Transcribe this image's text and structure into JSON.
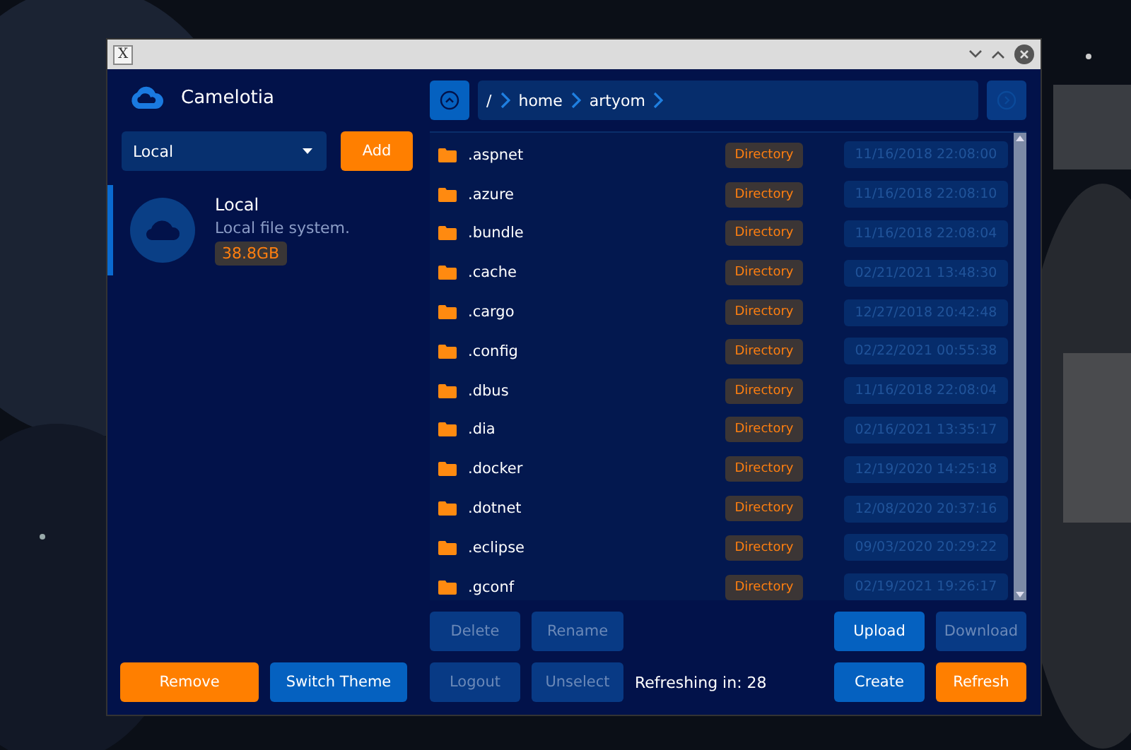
{
  "window": {
    "app_icon": "X"
  },
  "sidebar": {
    "app_name": "Camelotia",
    "storage_select": {
      "value": "Local"
    },
    "add_button": {
      "label": "Add",
      "kind": "accent",
      "disabled": false
    },
    "storages": [
      {
        "name": "Local",
        "description": "Local file system.",
        "size": "38.8GB",
        "selected": true
      }
    ],
    "buttons": [
      {
        "label": "Remove",
        "kind": "accent",
        "disabled": false
      },
      {
        "label": "Switch Theme",
        "kind": "primary",
        "disabled": false
      }
    ]
  },
  "breadcrumbs": [
    {
      "label": "/"
    },
    {
      "label": "home"
    },
    {
      "label": "artyom"
    }
  ],
  "files": [
    {
      "name": ".aspnet",
      "type": "Directory",
      "modified": "11/16/2018 22:08:00"
    },
    {
      "name": ".azure",
      "type": "Directory",
      "modified": "11/16/2018 22:08:10"
    },
    {
      "name": ".bundle",
      "type": "Directory",
      "modified": "11/16/2018 22:08:04"
    },
    {
      "name": ".cache",
      "type": "Directory",
      "modified": "02/21/2021 13:48:30"
    },
    {
      "name": ".cargo",
      "type": "Directory",
      "modified": "12/27/2018 20:42:48"
    },
    {
      "name": ".config",
      "type": "Directory",
      "modified": "02/22/2021 00:55:38"
    },
    {
      "name": ".dbus",
      "type": "Directory",
      "modified": "11/16/2018 22:08:04"
    },
    {
      "name": ".dia",
      "type": "Directory",
      "modified": "02/16/2021 13:35:17"
    },
    {
      "name": ".docker",
      "type": "Directory",
      "modified": "12/19/2020 14:25:18"
    },
    {
      "name": ".dotnet",
      "type": "Directory",
      "modified": "12/08/2020 20:37:16"
    },
    {
      "name": ".eclipse",
      "type": "Directory",
      "modified": "09/03/2020 20:29:22"
    },
    {
      "name": ".gconf",
      "type": "Directory",
      "modified": "02/19/2021 19:26:17"
    }
  ],
  "actions_row_1": [
    {
      "label": "Delete",
      "kind": "primary",
      "disabled": true
    },
    {
      "label": "Rename",
      "kind": "primary",
      "disabled": true
    },
    {
      "label": "Upload",
      "kind": "primary",
      "disabled": false
    },
    {
      "label": "Download",
      "kind": "primary",
      "disabled": true
    }
  ],
  "actions_row_2": [
    {
      "label": "Logout",
      "kind": "primary",
      "disabled": true
    },
    {
      "label": "Unselect",
      "kind": "primary",
      "disabled": true
    },
    {
      "label": "Create",
      "kind": "primary",
      "disabled": false
    },
    {
      "label": "Refresh",
      "kind": "accent",
      "disabled": false
    }
  ],
  "status": "Refreshing in: 28"
}
